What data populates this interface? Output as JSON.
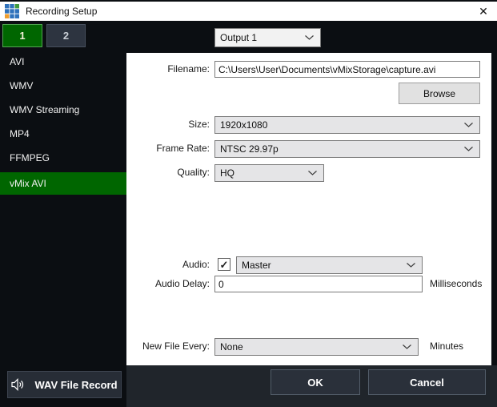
{
  "window": {
    "title": "Recording Setup",
    "close_glyph": "✕"
  },
  "colors": {
    "accent_green": "#006600",
    "tab_green_border": "#53a653",
    "logo_blue": "#2f72bc",
    "logo_green": "#3f9b3f",
    "logo_orange": "#f09e2e",
    "panel_white": "#ffffff",
    "footer_bg": "#20252b",
    "sidebar_bg": "#0b0e12"
  },
  "tabs": [
    {
      "label": "1",
      "selected": true
    },
    {
      "label": "2",
      "selected": false
    }
  ],
  "output_selector": {
    "value": "Output 1"
  },
  "sidebar": {
    "items": [
      {
        "label": "AVI",
        "selected": false
      },
      {
        "label": "WMV",
        "selected": false
      },
      {
        "label": "WMV Streaming",
        "selected": false
      },
      {
        "label": "MP4",
        "selected": false
      },
      {
        "label": "FFMPEG",
        "selected": false
      },
      {
        "label": "vMix AVI",
        "selected": true
      }
    ]
  },
  "form": {
    "filename": {
      "label": "Filename:",
      "value": "C:\\Users\\User\\Documents\\vMixStorage\\capture.avi"
    },
    "browse_label": "Browse",
    "size": {
      "label": "Size:",
      "value": "1920x1080"
    },
    "frame_rate": {
      "label": "Frame Rate:",
      "value": "NTSC 29.97p"
    },
    "quality": {
      "label": "Quality:",
      "value": "HQ"
    },
    "audio": {
      "label": "Audio:",
      "checked": true,
      "checkmark": "✓",
      "value": "Master"
    },
    "audio_delay": {
      "label": "Audio Delay:",
      "value": "0",
      "unit": "Milliseconds"
    },
    "new_file_every": {
      "label": "New File Every:",
      "value": "None",
      "unit": "Minutes"
    }
  },
  "footer": {
    "wav_button_label": "WAV File Record",
    "ok_label": "OK",
    "cancel_label": "Cancel"
  }
}
